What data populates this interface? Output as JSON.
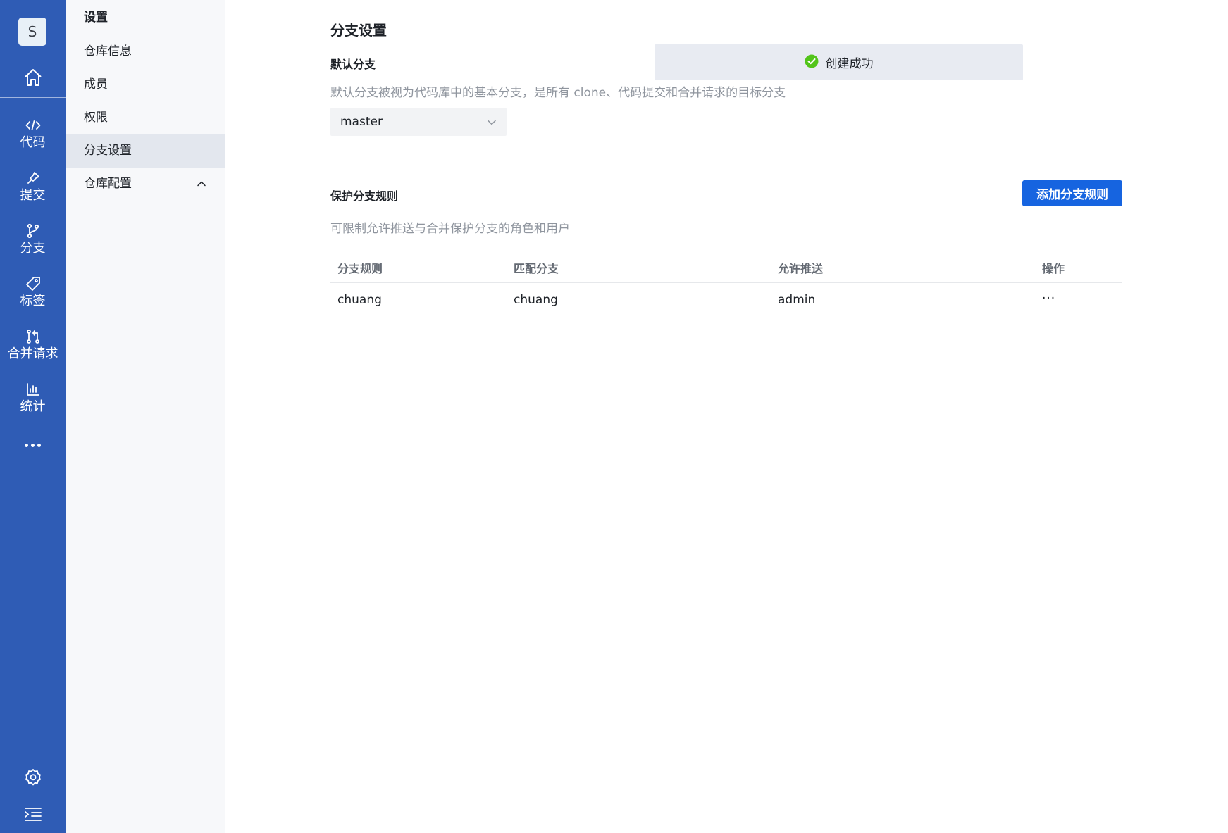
{
  "rail": {
    "avatar_letter": "S",
    "items": [
      {
        "label": "代码",
        "icon": "code-icon"
      },
      {
        "label": "提交",
        "icon": "pin-icon"
      },
      {
        "label": "分支",
        "icon": "branch-icon"
      },
      {
        "label": "标签",
        "icon": "tag-icon"
      },
      {
        "label": "合并请求",
        "icon": "merge-request-icon"
      },
      {
        "label": "统计",
        "icon": "bar-chart-icon"
      }
    ]
  },
  "sidebar": {
    "title": "设置",
    "items": [
      {
        "label": "仓库信息"
      },
      {
        "label": "成员"
      },
      {
        "label": "权限"
      },
      {
        "label": "分支设置",
        "active": true
      },
      {
        "label": "仓库配置",
        "expanded": true
      }
    ]
  },
  "main": {
    "title": "分支设置",
    "default_branch": {
      "label": "默认分支",
      "description": "默认分支被视为代码库中的基本分支，是所有 clone、代码提交和合并请求的目标分支",
      "selected": "master"
    },
    "protected": {
      "label": "保护分支规则",
      "description": "可限制允许推送与合并保护分支的角色和用户",
      "add_button": "添加分支规则",
      "columns": [
        "分支规则",
        "匹配分支",
        "允许推送",
        "操作"
      ],
      "rows": [
        {
          "rule": "chuang",
          "match": "chuang",
          "push": "admin",
          "action": "···"
        }
      ]
    }
  },
  "toast": {
    "text": "创建成功",
    "icon": "success-check-icon",
    "color": "#52c41a"
  },
  "colors": {
    "rail_bg": "#2f5cb5",
    "primary": "#1664e0",
    "sidebar_bg": "#f7f8fa",
    "active_bg": "#e3e7ee"
  }
}
